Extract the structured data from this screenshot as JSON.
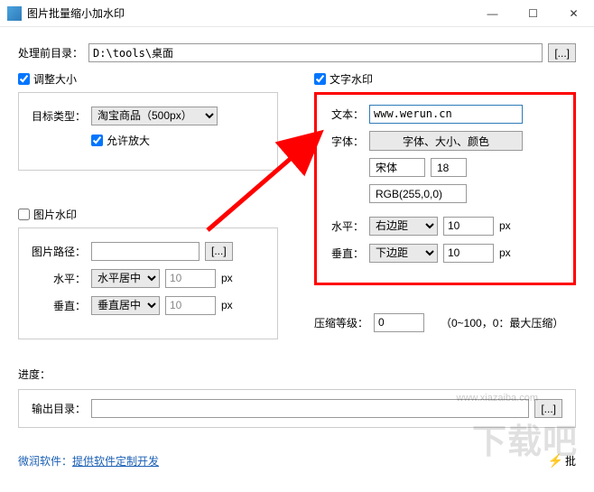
{
  "window": {
    "title": "图片批量缩小加水印"
  },
  "source": {
    "label": "处理前目录：",
    "path": "D:\\tools\\桌面",
    "browse": "[...]"
  },
  "resize": {
    "enable_label": "调整大小",
    "type_label": "目标类型：",
    "type_value": "淘宝商品（500px）",
    "allow_enlarge": "允许放大"
  },
  "img_wm": {
    "enable_label": "图片水印",
    "path_label": "图片路径：",
    "path_value": "",
    "browse": "[...]",
    "h_label": "水平：",
    "h_mode": "水平居中",
    "h_val": "10",
    "h_unit": "px",
    "v_label": "垂直：",
    "v_mode": "垂直居中",
    "v_val": "10",
    "v_unit": "px"
  },
  "txt_wm": {
    "enable_label": "文字水印",
    "text_label": "文本：",
    "text_value": "www.werun.cn",
    "font_label": "字体：",
    "font_btn": "字体、大小、颜色",
    "font_name": "宋体",
    "font_size": "18",
    "font_color": "RGB(255,0,0)",
    "h_label": "水平：",
    "h_mode": "右边距",
    "h_val": "10",
    "h_unit": "px",
    "v_label": "垂直：",
    "v_mode": "下边距",
    "v_val": "10",
    "v_unit": "px"
  },
  "compress": {
    "label": "压缩等级：",
    "value": "0",
    "hint": "（0~100，0：最大压缩）"
  },
  "progress": {
    "label": "进度："
  },
  "output": {
    "label": "输出目录：",
    "path": "",
    "browse": "[...]"
  },
  "footer": {
    "vendor": "微润软件：",
    "link": "提供软件定制开发",
    "action": "批"
  },
  "watermark": {
    "big": "下载吧",
    "url": "www.xiazaiba.com"
  }
}
